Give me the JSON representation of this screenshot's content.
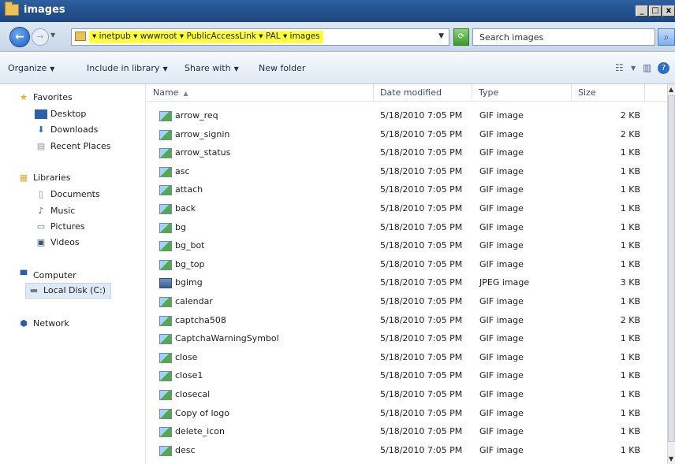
{
  "window": {
    "title": "images"
  },
  "address": {
    "breadcrumb_text": "▾ inetpub ▾ wwwroot ▾ PublicAccessLink ▾ PAL ▾ images",
    "search_placeholder": "Search images"
  },
  "toolbar": {
    "organize": "Organize",
    "include_in_library": "Include in library",
    "share_with": "Share with",
    "new_folder": "New folder"
  },
  "sidebar": {
    "favorites": "Favorites",
    "desktop": "Desktop",
    "downloads": "Downloads",
    "recent_places": "Recent Places",
    "libraries": "Libraries",
    "documents": "Documents",
    "music": "Music",
    "pictures": "Pictures",
    "videos": "Videos",
    "computer": "Computer",
    "local_disk": "Local Disk (C:)",
    "network": "Network"
  },
  "columns": {
    "name": "Name",
    "date_modified": "Date modified",
    "type": "Type",
    "size": "Size"
  },
  "files": [
    {
      "name": "arrow_req",
      "date": "5/18/2010 7:05 PM",
      "type": "GIF image",
      "size": "2 KB"
    },
    {
      "name": "arrow_signin",
      "date": "5/18/2010 7:05 PM",
      "type": "GIF image",
      "size": "2 KB"
    },
    {
      "name": "arrow_status",
      "date": "5/18/2010 7:05 PM",
      "type": "GIF image",
      "size": "1 KB"
    },
    {
      "name": "asc",
      "date": "5/18/2010 7:05 PM",
      "type": "GIF image",
      "size": "1 KB"
    },
    {
      "name": "attach",
      "date": "5/18/2010 7:05 PM",
      "type": "GIF image",
      "size": "1 KB"
    },
    {
      "name": "back",
      "date": "5/18/2010 7:05 PM",
      "type": "GIF image",
      "size": "1 KB"
    },
    {
      "name": "bg",
      "date": "5/18/2010 7:05 PM",
      "type": "GIF image",
      "size": "1 KB"
    },
    {
      "name": "bg_bot",
      "date": "5/18/2010 7:05 PM",
      "type": "GIF image",
      "size": "1 KB"
    },
    {
      "name": "bg_top",
      "date": "5/18/2010 7:05 PM",
      "type": "GIF image",
      "size": "1 KB"
    },
    {
      "name": "bgimg",
      "date": "5/18/2010 7:05 PM",
      "type": "JPEG image",
      "size": "3 KB"
    },
    {
      "name": "calendar",
      "date": "5/18/2010 7:05 PM",
      "type": "GIF image",
      "size": "1 KB"
    },
    {
      "name": "captcha508",
      "date": "5/18/2010 7:05 PM",
      "type": "GIF image",
      "size": "2 KB"
    },
    {
      "name": "CaptchaWarningSymbol",
      "date": "5/18/2010 7:05 PM",
      "type": "GIF image",
      "size": "1 KB"
    },
    {
      "name": "close",
      "date": "5/18/2010 7:05 PM",
      "type": "GIF image",
      "size": "1 KB"
    },
    {
      "name": "close1",
      "date": "5/18/2010 7:05 PM",
      "type": "GIF image",
      "size": "1 KB"
    },
    {
      "name": "closecal",
      "date": "5/18/2010 7:05 PM",
      "type": "GIF image",
      "size": "1 KB"
    },
    {
      "name": "Copy of logo",
      "date": "5/18/2010 7:05 PM",
      "type": "GIF image",
      "size": "1 KB"
    },
    {
      "name": "delete_icon",
      "date": "5/18/2010 7:05 PM",
      "type": "GIF image",
      "size": "1 KB"
    },
    {
      "name": "desc",
      "date": "5/18/2010 7:05 PM",
      "type": "GIF image",
      "size": "1 KB"
    }
  ]
}
